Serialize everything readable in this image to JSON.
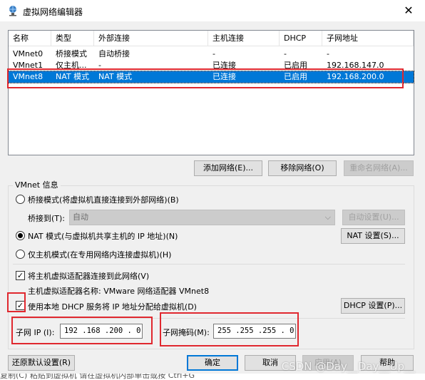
{
  "window": {
    "title": "虚拟网络编辑器",
    "close_glyph": "✕"
  },
  "table": {
    "headers": [
      "名称",
      "类型",
      "外部连接",
      "主机连接",
      "DHCP",
      "子网地址"
    ],
    "rows": [
      {
        "name": "VMnet0",
        "type": "桥接模式",
        "external": "自动桥接",
        "host": "-",
        "dhcp": "-",
        "subnet": "-"
      },
      {
        "name": "VMnet1",
        "type": "仅主机...",
        "external": "-",
        "host": "已连接",
        "dhcp": "已启用",
        "subnet": "192.168.147.0"
      },
      {
        "name": "VMnet8",
        "type": "NAT 模式",
        "external": "NAT 模式",
        "host": "已连接",
        "dhcp": "已启用",
        "subnet": "192.168.200.0"
      }
    ],
    "selected_row": "VMnet8"
  },
  "buttons": {
    "add_network": "添加网络(E)...",
    "remove_network": "移除网络(O)",
    "rename_network": "重命名网络(A)...",
    "auto_settings": "自动设置(U)...",
    "nat_settings": "NAT 设置(S)...",
    "dhcp_settings": "DHCP 设置(P)...",
    "restore_defaults": "还原默认设置(R)",
    "ok": "确定",
    "cancel": "取消",
    "apply": "应用(A)",
    "help": "帮助"
  },
  "vmnet_info": {
    "group_label": "VMnet 信息",
    "bridged_label": "桥接模式(将虚拟机直接连接到外部网络)(B)",
    "bridged_to_label": "桥接到(T):",
    "bridged_to_value": "自动",
    "nat_label": "NAT 模式(与虚拟机共享主机的 IP 地址)(N)",
    "host_only_label": "仅主机模式(在专用网络内连接虚拟机)(H)",
    "selected_mode": "nat",
    "connect_adapter_label": "将主机虚拟适配器连接到此网络(V)",
    "connect_adapter_checked": true,
    "adapter_name_label": "主机虚拟适配器名称: VMware 网络适配器 VMnet8",
    "use_dhcp_label": "使用本地 DHCP 服务将 IP 地址分配给虚拟机(D)",
    "use_dhcp_checked": true,
    "subnet_ip_label": "子网 IP (I):",
    "subnet_ip_value": "192 .168 .200 . 0",
    "subnet_mask_label": "子网掩码(M):",
    "subnet_mask_value": "255 .255 .255 . 0"
  },
  "watermark": "CSDN @Day__Day__Up__",
  "bottom_strip_text": "复制(C) 粘贴到虚拟机 请在虚拟机内部单击或按 Ctrl+G",
  "annotation_color": "#e0282f",
  "selection_color": "#0078d7"
}
